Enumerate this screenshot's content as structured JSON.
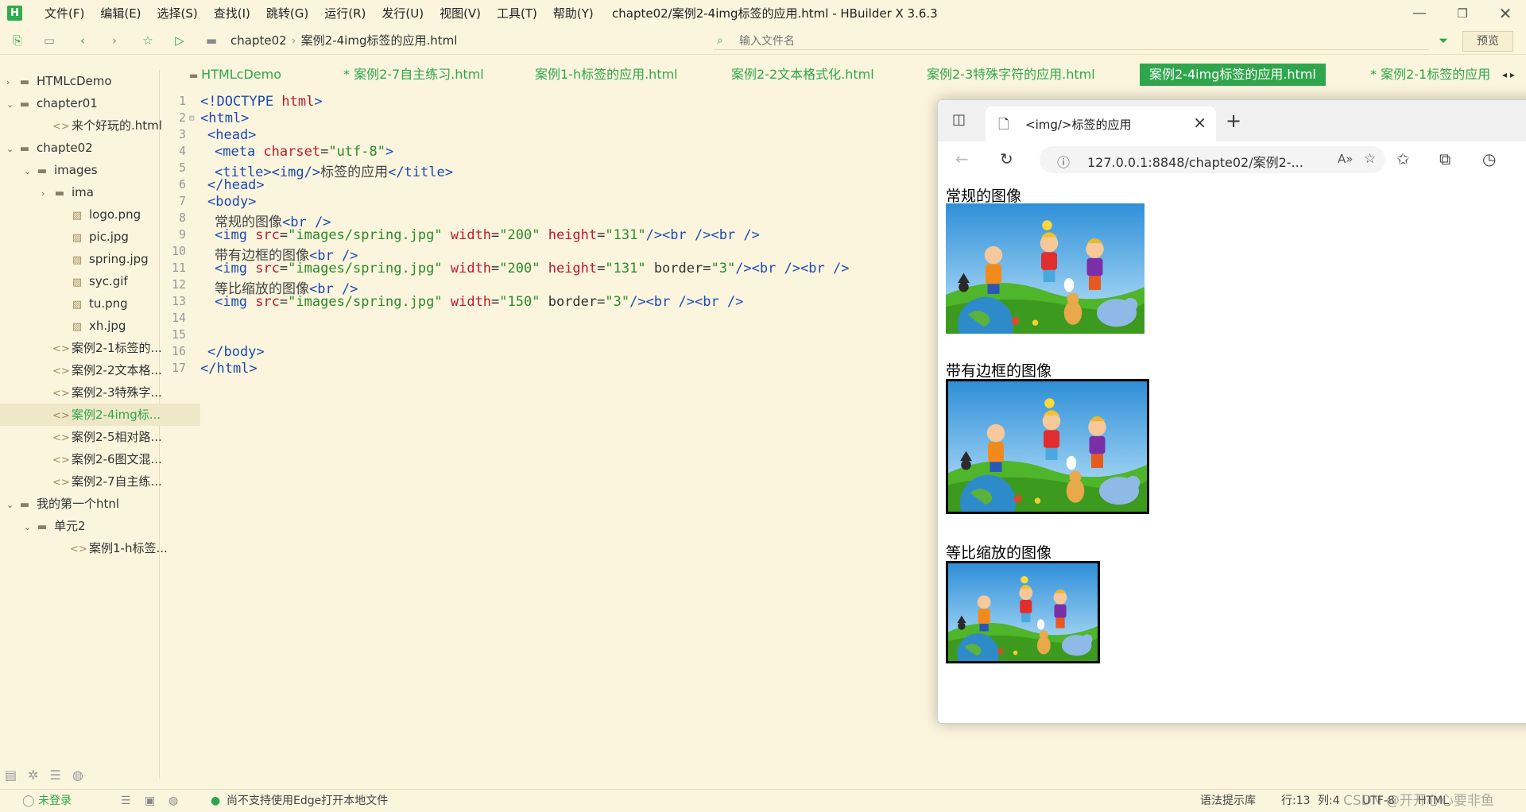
{
  "app": {
    "logo": "H",
    "menu": [
      "文件(F)",
      "编辑(E)",
      "选择(S)",
      "查找(I)",
      "跳转(G)",
      "运行(R)",
      "发行(U)",
      "视图(V)",
      "工具(T)",
      "帮助(Y)"
    ],
    "title": "chapte02/案例2-4img标签的应用.html - HBuilder X 3.6.3"
  },
  "toolbar": {
    "breadcrumb": [
      "chapte02",
      "案例2-4img标签的应用.html"
    ],
    "search_placeholder": "输入文件名",
    "preview_label": "预览"
  },
  "sidebar": {
    "items": [
      {
        "label": "HTMLcDemo",
        "depth": 0,
        "arrow": "›",
        "icon": "folder"
      },
      {
        "label": "chapter01",
        "depth": 0,
        "arrow": "⌄",
        "icon": "folder"
      },
      {
        "label": "来个好玩的.html",
        "depth": 2,
        "arrow": "",
        "icon": "html"
      },
      {
        "label": "chapte02",
        "depth": 0,
        "arrow": "⌄",
        "icon": "folder"
      },
      {
        "label": "images",
        "depth": 1,
        "arrow": "⌄",
        "icon": "folder"
      },
      {
        "label": "ima",
        "depth": 2,
        "arrow": "›",
        "icon": "folder"
      },
      {
        "label": "logo.png",
        "depth": 3,
        "arrow": "",
        "icon": "image"
      },
      {
        "label": "pic.jpg",
        "depth": 3,
        "arrow": "",
        "icon": "image"
      },
      {
        "label": "spring.jpg",
        "depth": 3,
        "arrow": "",
        "icon": "image"
      },
      {
        "label": "syc.gif",
        "depth": 3,
        "arrow": "",
        "icon": "image"
      },
      {
        "label": "tu.png",
        "depth": 3,
        "arrow": "",
        "icon": "image"
      },
      {
        "label": "xh.jpg",
        "depth": 3,
        "arrow": "",
        "icon": "image"
      },
      {
        "label": "案例2-1标签的...",
        "depth": 2,
        "arrow": "",
        "icon": "html"
      },
      {
        "label": "案例2-2文本格...",
        "depth": 2,
        "arrow": "",
        "icon": "html"
      },
      {
        "label": "案例2-3特殊字...",
        "depth": 2,
        "arrow": "",
        "icon": "html"
      },
      {
        "label": "案例2-4img标...",
        "depth": 2,
        "arrow": "",
        "icon": "html",
        "selected": true
      },
      {
        "label": "案例2-5相对路...",
        "depth": 2,
        "arrow": "",
        "icon": "html"
      },
      {
        "label": "案例2-6图文混...",
        "depth": 2,
        "arrow": "",
        "icon": "html"
      },
      {
        "label": "案例2-7自主练...",
        "depth": 2,
        "arrow": "",
        "icon": "html"
      },
      {
        "label": "我的第一个htnl",
        "depth": 0,
        "arrow": "⌄",
        "icon": "folder"
      },
      {
        "label": "单元2",
        "depth": 1,
        "arrow": "⌄",
        "icon": "folder"
      },
      {
        "label": "案例1-h标签...",
        "depth": 3,
        "arrow": "",
        "icon": "html"
      }
    ]
  },
  "tabs": [
    {
      "label": "HTMLcDemo",
      "active": false
    },
    {
      "label": "* 案例2-7自主练习.html",
      "active": false
    },
    {
      "label": "案例1-h标签的应用.html",
      "active": false
    },
    {
      "label": "案例2-2文本格式化.html",
      "active": false
    },
    {
      "label": "案例2-3特殊字符的应用.html",
      "active": false
    },
    {
      "label": "案例2-4img标签的应用.html",
      "active": true
    },
    {
      "label": "* 案例2-1标签的应用",
      "active": false
    }
  ],
  "code": {
    "line_numbers": [
      "1",
      "2",
      "3",
      "4",
      "5",
      "6",
      "7",
      "8",
      "9",
      "10",
      "11",
      "12",
      "13",
      "14",
      "15",
      "16",
      "17"
    ],
    "l1_a": "<!DOCTYPE",
    "l1_b": " html",
    "l1_c": ">",
    "l2": "<html>",
    "l3": "<head>",
    "l4_a": "<meta",
    "l4_b": " charset",
    "l4_c": "=",
    "l4_d": "\"utf-8\"",
    "l4_e": ">",
    "l5_a": "<title>",
    "l5_b": "<img/>",
    "l5_c": "标签的应用",
    "l5_d": "</title>",
    "l6": "</head>",
    "l7": "<body>",
    "l8_a": "常规的图像",
    "l8_b": "<br />",
    "l9_a": "<img",
    "l9_b": " src",
    "l9_c": "=",
    "l9_d": "\"images/spring.jpg\"",
    "l9_e": " width",
    "l9_f": "=",
    "l9_g": "\"200\"",
    "l9_h": " height",
    "l9_i": "=",
    "l9_j": "\"131\"",
    "l9_k": "/><br /><br />",
    "l10_a": "带有边框的图像",
    "l10_b": "<br />",
    "l11_a": "<img",
    "l11_b": " src",
    "l11_c": "=",
    "l11_d": "\"images/spring.jpg\"",
    "l11_e": " width",
    "l11_f": "=",
    "l11_g": "\"200\"",
    "l11_h": " height",
    "l11_i": "=",
    "l11_j": "\"131\"",
    "l11_k": " border=",
    "l11_l": "\"3\"",
    "l11_m": "/><br /><br />",
    "l12_a": "等比缩放的图像",
    "l12_b": "<br />",
    "l13_a": "<img",
    "l13_b": " src",
    "l13_c": "=",
    "l13_d": "\"images/spring.jpg\"",
    "l13_e": " width",
    "l13_f": "=",
    "l13_g": "\"150\"",
    "l13_h": " border=",
    "l13_i": "\"3\"",
    "l13_j": "/><br /><br />",
    "l16": "</body>",
    "l17": "</html>"
  },
  "browser": {
    "tab_title": "<img/>标签的应用",
    "url": "127.0.0.1:8848/chapte02/案例2-...",
    "page": {
      "caption1": "常规的图像",
      "caption2": "带有边框的图像",
      "caption3": "等比缩放的图像"
    }
  },
  "statusbar": {
    "login": "未登录",
    "message": "尚不支持使用Edge打开本地文件",
    "hint_lib": "语法提示库",
    "line": "行:13",
    "col": "列:4",
    "encoding": "UTF-8",
    "lang": "HTML",
    "watermark": "CSDN @开开心心要非鱼"
  },
  "colors": {
    "accent": "#2fa64c",
    "background": "#fbf5dd",
    "tag": "#1c49b8",
    "attr": "#c0182e",
    "string": "#2a8a2a"
  }
}
